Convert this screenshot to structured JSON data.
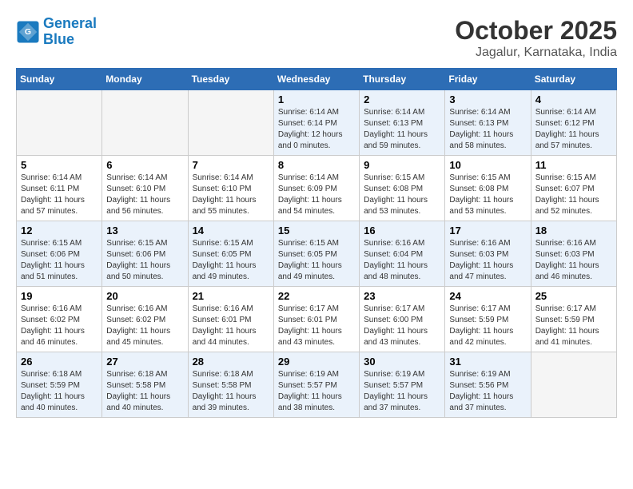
{
  "header": {
    "logo_line1": "General",
    "logo_line2": "Blue",
    "month": "October 2025",
    "location": "Jagalur, Karnataka, India"
  },
  "weekdays": [
    "Sunday",
    "Monday",
    "Tuesday",
    "Wednesday",
    "Thursday",
    "Friday",
    "Saturday"
  ],
  "weeks": [
    [
      {
        "day": "",
        "info": ""
      },
      {
        "day": "",
        "info": ""
      },
      {
        "day": "",
        "info": ""
      },
      {
        "day": "1",
        "info": "Sunrise: 6:14 AM\nSunset: 6:14 PM\nDaylight: 12 hours\nand 0 minutes."
      },
      {
        "day": "2",
        "info": "Sunrise: 6:14 AM\nSunset: 6:13 PM\nDaylight: 11 hours\nand 59 minutes."
      },
      {
        "day": "3",
        "info": "Sunrise: 6:14 AM\nSunset: 6:13 PM\nDaylight: 11 hours\nand 58 minutes."
      },
      {
        "day": "4",
        "info": "Sunrise: 6:14 AM\nSunset: 6:12 PM\nDaylight: 11 hours\nand 57 minutes."
      }
    ],
    [
      {
        "day": "5",
        "info": "Sunrise: 6:14 AM\nSunset: 6:11 PM\nDaylight: 11 hours\nand 57 minutes."
      },
      {
        "day": "6",
        "info": "Sunrise: 6:14 AM\nSunset: 6:10 PM\nDaylight: 11 hours\nand 56 minutes."
      },
      {
        "day": "7",
        "info": "Sunrise: 6:14 AM\nSunset: 6:10 PM\nDaylight: 11 hours\nand 55 minutes."
      },
      {
        "day": "8",
        "info": "Sunrise: 6:14 AM\nSunset: 6:09 PM\nDaylight: 11 hours\nand 54 minutes."
      },
      {
        "day": "9",
        "info": "Sunrise: 6:15 AM\nSunset: 6:08 PM\nDaylight: 11 hours\nand 53 minutes."
      },
      {
        "day": "10",
        "info": "Sunrise: 6:15 AM\nSunset: 6:08 PM\nDaylight: 11 hours\nand 53 minutes."
      },
      {
        "day": "11",
        "info": "Sunrise: 6:15 AM\nSunset: 6:07 PM\nDaylight: 11 hours\nand 52 minutes."
      }
    ],
    [
      {
        "day": "12",
        "info": "Sunrise: 6:15 AM\nSunset: 6:06 PM\nDaylight: 11 hours\nand 51 minutes."
      },
      {
        "day": "13",
        "info": "Sunrise: 6:15 AM\nSunset: 6:06 PM\nDaylight: 11 hours\nand 50 minutes."
      },
      {
        "day": "14",
        "info": "Sunrise: 6:15 AM\nSunset: 6:05 PM\nDaylight: 11 hours\nand 49 minutes."
      },
      {
        "day": "15",
        "info": "Sunrise: 6:15 AM\nSunset: 6:05 PM\nDaylight: 11 hours\nand 49 minutes."
      },
      {
        "day": "16",
        "info": "Sunrise: 6:16 AM\nSunset: 6:04 PM\nDaylight: 11 hours\nand 48 minutes."
      },
      {
        "day": "17",
        "info": "Sunrise: 6:16 AM\nSunset: 6:03 PM\nDaylight: 11 hours\nand 47 minutes."
      },
      {
        "day": "18",
        "info": "Sunrise: 6:16 AM\nSunset: 6:03 PM\nDaylight: 11 hours\nand 46 minutes."
      }
    ],
    [
      {
        "day": "19",
        "info": "Sunrise: 6:16 AM\nSunset: 6:02 PM\nDaylight: 11 hours\nand 46 minutes."
      },
      {
        "day": "20",
        "info": "Sunrise: 6:16 AM\nSunset: 6:02 PM\nDaylight: 11 hours\nand 45 minutes."
      },
      {
        "day": "21",
        "info": "Sunrise: 6:16 AM\nSunset: 6:01 PM\nDaylight: 11 hours\nand 44 minutes."
      },
      {
        "day": "22",
        "info": "Sunrise: 6:17 AM\nSunset: 6:01 PM\nDaylight: 11 hours\nand 43 minutes."
      },
      {
        "day": "23",
        "info": "Sunrise: 6:17 AM\nSunset: 6:00 PM\nDaylight: 11 hours\nand 43 minutes."
      },
      {
        "day": "24",
        "info": "Sunrise: 6:17 AM\nSunset: 5:59 PM\nDaylight: 11 hours\nand 42 minutes."
      },
      {
        "day": "25",
        "info": "Sunrise: 6:17 AM\nSunset: 5:59 PM\nDaylight: 11 hours\nand 41 minutes."
      }
    ],
    [
      {
        "day": "26",
        "info": "Sunrise: 6:18 AM\nSunset: 5:59 PM\nDaylight: 11 hours\nand 40 minutes."
      },
      {
        "day": "27",
        "info": "Sunrise: 6:18 AM\nSunset: 5:58 PM\nDaylight: 11 hours\nand 40 minutes."
      },
      {
        "day": "28",
        "info": "Sunrise: 6:18 AM\nSunset: 5:58 PM\nDaylight: 11 hours\nand 39 minutes."
      },
      {
        "day": "29",
        "info": "Sunrise: 6:19 AM\nSunset: 5:57 PM\nDaylight: 11 hours\nand 38 minutes."
      },
      {
        "day": "30",
        "info": "Sunrise: 6:19 AM\nSunset: 5:57 PM\nDaylight: 11 hours\nand 37 minutes."
      },
      {
        "day": "31",
        "info": "Sunrise: 6:19 AM\nSunset: 5:56 PM\nDaylight: 11 hours\nand 37 minutes."
      },
      {
        "day": "",
        "info": ""
      }
    ]
  ]
}
